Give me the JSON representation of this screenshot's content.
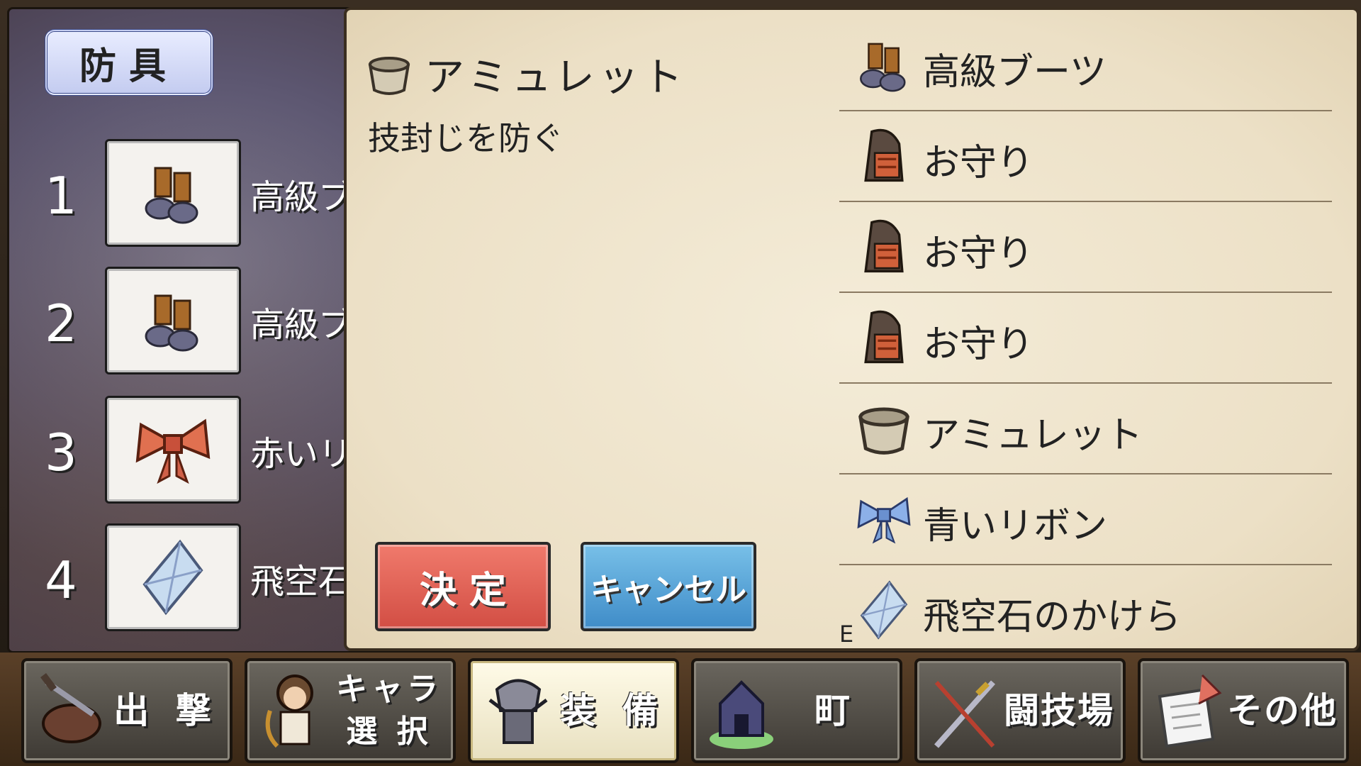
{
  "category": "防具",
  "slots": [
    {
      "num": "1",
      "name": "高級ブ",
      "icon": "boots-icon"
    },
    {
      "num": "2",
      "name": "高級ブ",
      "icon": "boots-icon"
    },
    {
      "num": "3",
      "name": "赤いリ",
      "icon": "red-ribbon-icon"
    },
    {
      "num": "4",
      "name": "飛空石",
      "icon": "crystal-icon"
    }
  ],
  "detail": {
    "title": "アミュレット",
    "description": "技封じを防ぐ",
    "icon": "amulet-icon"
  },
  "buttons": {
    "ok": "決 定",
    "cancel": "キャンセル"
  },
  "list": [
    {
      "label": "高級ブーツ",
      "icon": "boots-icon"
    },
    {
      "label": "お守り",
      "icon": "charm-icon"
    },
    {
      "label": "お守り",
      "icon": "charm-icon"
    },
    {
      "label": "お守り",
      "icon": "charm-icon"
    },
    {
      "label": "アミュレット",
      "icon": "amulet-icon"
    },
    {
      "label": "青いリボン",
      "icon": "blue-ribbon-icon"
    },
    {
      "label": "飛空石のかけら",
      "icon": "crystal-icon",
      "mark": "E"
    }
  ],
  "nav": [
    {
      "label": "出 撃",
      "icon": "sortie-icon"
    },
    {
      "label": "キャラ 選 択",
      "icon": "character-select-icon"
    },
    {
      "label": "装 備",
      "icon": "equipment-icon",
      "active": true
    },
    {
      "label": "町",
      "icon": "town-icon"
    },
    {
      "label": "闘技場",
      "icon": "arena-icon"
    },
    {
      "label": "その他",
      "icon": "others-icon"
    }
  ],
  "colors": {
    "ok": "#d24e44",
    "cancel": "#3f8cc8",
    "parchment": "#f4ecd8"
  }
}
